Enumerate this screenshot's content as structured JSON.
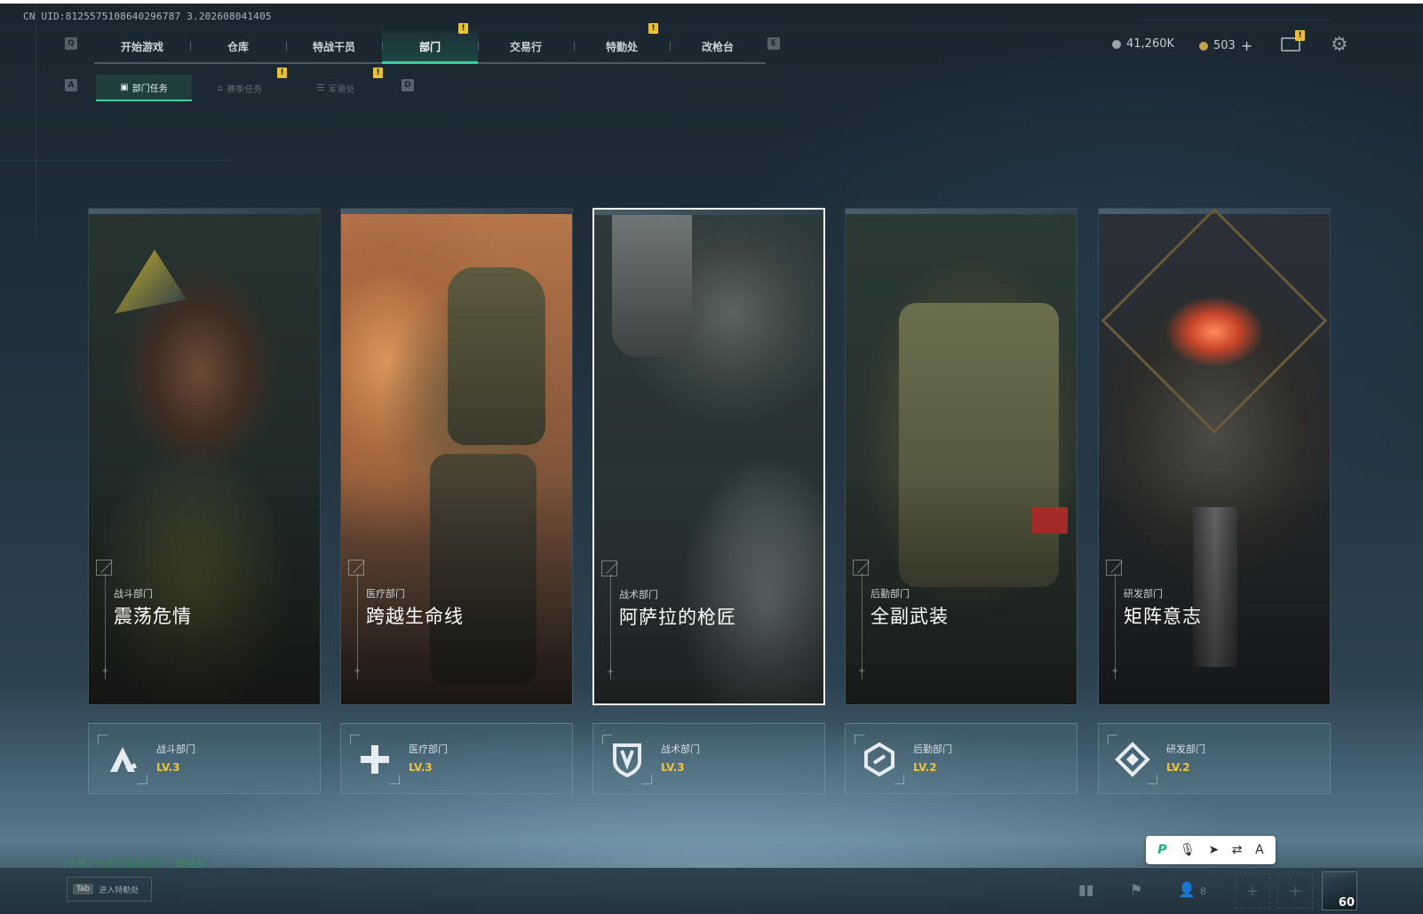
{
  "uid": "CN UID:8125575108640296787 3.202608041405",
  "nav": {
    "prev_key": "Q",
    "next_key": "E",
    "tabs": [
      {
        "label": "开始游戏"
      },
      {
        "label": "仓库"
      },
      {
        "label": "特战干员"
      },
      {
        "label": "部门",
        "active": true
      },
      {
        "label": "交易行"
      },
      {
        "label": "特勤处"
      },
      {
        "label": "改枪台"
      }
    ],
    "alert_mark": "!"
  },
  "subnav": {
    "prev_key": "A",
    "next_key": "D",
    "tabs": [
      {
        "label": "部门任务",
        "active": true
      },
      {
        "label": "赛季任务"
      },
      {
        "label": "军需处"
      }
    ]
  },
  "currency": {
    "coins": "41,260K",
    "tokens": "503",
    "add": "+"
  },
  "cards": [
    {
      "category": "战斗部门",
      "title": "震荡危情",
      "art": "combat-operator"
    },
    {
      "category": "医疗部门",
      "title": "跨越生命线",
      "art": "medic-carrying-soldier"
    },
    {
      "category": "战术部门",
      "title": "阿萨拉的枪匠",
      "art": "tactical-operator-helmet",
      "selected": true
    },
    {
      "category": "后勤部门",
      "title": "全副武装",
      "art": "plate-carrier-vest"
    },
    {
      "category": "研发部门",
      "title": "矩阵意志",
      "art": "glowing-core-device"
    }
  ],
  "departments": [
    {
      "name": "战斗部门",
      "level": "LV.3",
      "icon": "combat-emblem-icon"
    },
    {
      "name": "医疗部门",
      "level": "LV.3",
      "icon": "medical-cross-icon"
    },
    {
      "name": "战术部门",
      "level": "LV.3",
      "icon": "shield-emblem-icon"
    },
    {
      "name": "后勤部门",
      "level": "LV.2",
      "icon": "logistics-emblem-icon"
    },
    {
      "name": "研发部门",
      "level": "LV.2",
      "icon": "rnd-emblem-icon"
    }
  ],
  "chat": {
    "channel": "[世界]",
    "sender": "地球的末日余辉",
    "message": "：摸摸进"
  },
  "bottom": {
    "tab_key": "Tab",
    "tab_label": "进入特勤处",
    "friends_count": "8",
    "level": "60"
  },
  "colors": {
    "accent_green": "#2fd39a",
    "level_gold": "#f0c23a",
    "alert_yellow": "#e8c13a"
  }
}
